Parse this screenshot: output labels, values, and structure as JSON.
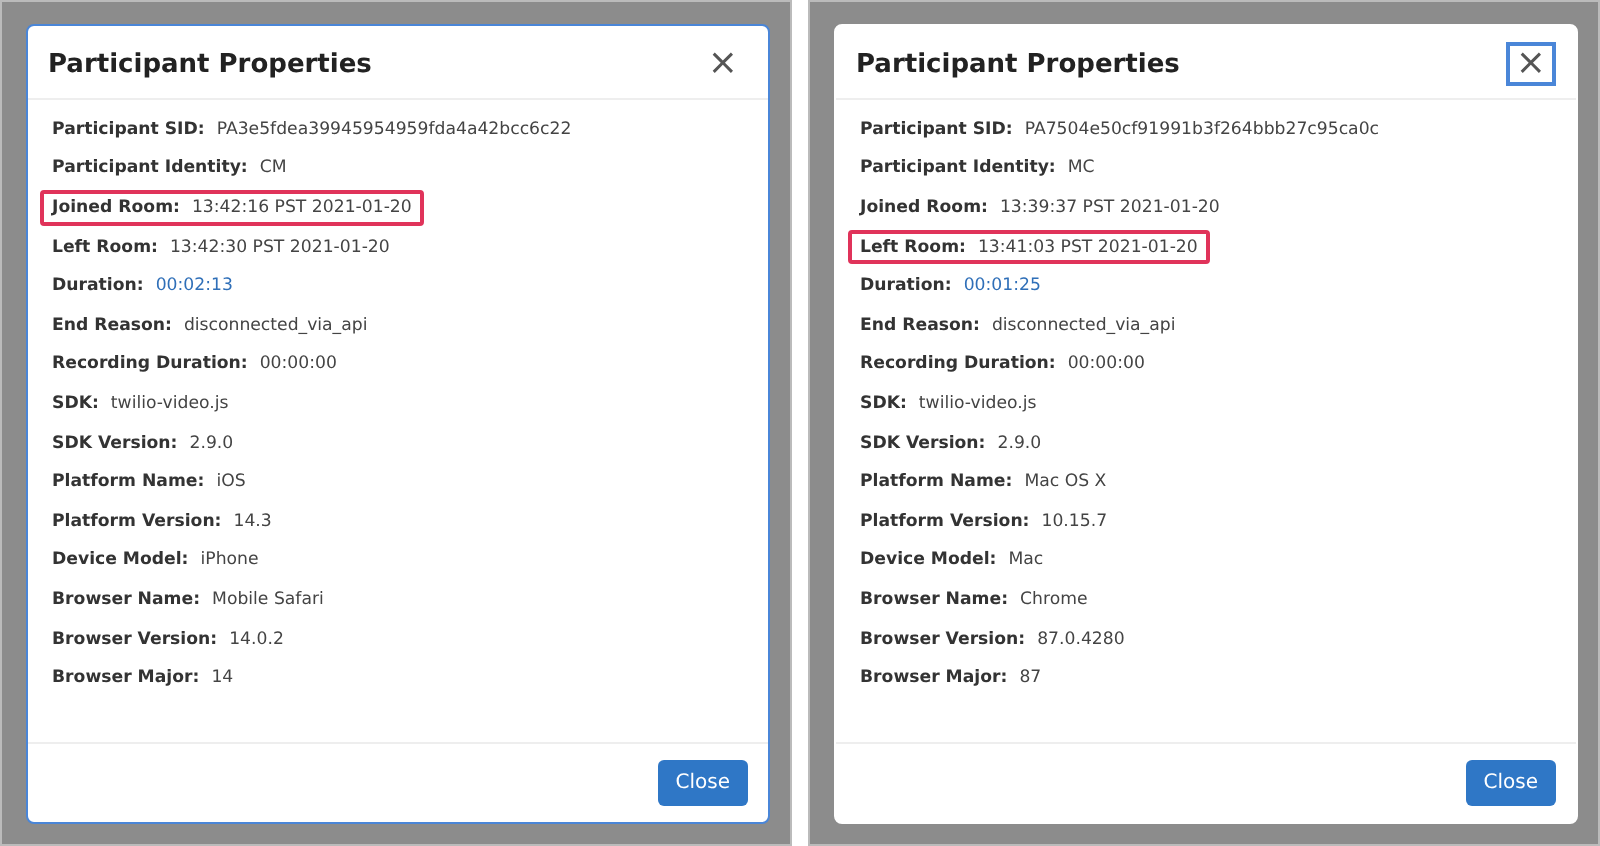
{
  "dialogs": [
    {
      "title": "Participant Properties",
      "focused": true,
      "close_focused": false,
      "close_label": "×",
      "button": "Close",
      "fields": [
        {
          "label": "Participant SID:",
          "value": "PA3e5fdea39945954959fda4a42bcc6c22",
          "kind": "text",
          "highlighted": false
        },
        {
          "label": "Participant Identity:",
          "value": "CM",
          "kind": "text",
          "highlighted": false
        },
        {
          "label": "Joined Room:",
          "value": "13:42:16 PST 2021-01-20",
          "kind": "text",
          "highlighted": true
        },
        {
          "label": "Left Room:",
          "value": "13:42:30 PST 2021-01-20",
          "kind": "text",
          "highlighted": false
        },
        {
          "label": "Duration:",
          "value": "00:02:13",
          "kind": "link",
          "highlighted": false
        },
        {
          "label": "End Reason:",
          "value": "disconnected_via_api",
          "kind": "text",
          "highlighted": false
        },
        {
          "label": "Recording Duration:",
          "value": "00:00:00",
          "kind": "text",
          "highlighted": false
        },
        {
          "label": "SDK:",
          "value": "twilio-video.js",
          "kind": "text",
          "highlighted": false
        },
        {
          "label": "SDK Version:",
          "value": "2.9.0",
          "kind": "text",
          "highlighted": false
        },
        {
          "label": "Platform Name:",
          "value": "iOS",
          "kind": "text",
          "highlighted": false
        },
        {
          "label": "Platform Version:",
          "value": "14.3",
          "kind": "text",
          "highlighted": false
        },
        {
          "label": "Device Model:",
          "value": "iPhone",
          "kind": "text",
          "highlighted": false
        },
        {
          "label": "Browser Name:",
          "value": "Mobile Safari",
          "kind": "text",
          "highlighted": false
        },
        {
          "label": "Browser Version:",
          "value": "14.0.2",
          "kind": "text",
          "highlighted": false
        },
        {
          "label": "Browser Major:",
          "value": "14",
          "kind": "text",
          "highlighted": false
        }
      ]
    },
    {
      "title": "Participant Properties",
      "focused": false,
      "close_focused": true,
      "close_label": "×",
      "button": "Close",
      "fields": [
        {
          "label": "Participant SID:",
          "value": "PA7504e50cf91991b3f264bbb27c95ca0c",
          "kind": "text",
          "highlighted": false
        },
        {
          "label": "Participant Identity:",
          "value": "MC",
          "kind": "text",
          "highlighted": false
        },
        {
          "label": "Joined Room:",
          "value": "13:39:37 PST 2021-01-20",
          "kind": "text",
          "highlighted": false
        },
        {
          "label": "Left Room:",
          "value": "13:41:03 PST 2021-01-20",
          "kind": "text",
          "highlighted": true
        },
        {
          "label": "Duration:",
          "value": "00:01:25",
          "kind": "link",
          "highlighted": false
        },
        {
          "label": "End Reason:",
          "value": "disconnected_via_api",
          "kind": "text",
          "highlighted": false
        },
        {
          "label": "Recording Duration:",
          "value": "00:00:00",
          "kind": "text",
          "highlighted": false
        },
        {
          "label": "SDK:",
          "value": "twilio-video.js",
          "kind": "text",
          "highlighted": false
        },
        {
          "label": "SDK Version:",
          "value": "2.9.0",
          "kind": "text",
          "highlighted": false
        },
        {
          "label": "Platform Name:",
          "value": "Mac OS X",
          "kind": "text",
          "highlighted": false
        },
        {
          "label": "Platform Version:",
          "value": "10.15.7",
          "kind": "text",
          "highlighted": false
        },
        {
          "label": "Device Model:",
          "value": "Mac",
          "kind": "text",
          "highlighted": false
        },
        {
          "label": "Browser Name:",
          "value": "Chrome",
          "kind": "text",
          "highlighted": false
        },
        {
          "label": "Browser Version:",
          "value": "87.0.4280",
          "kind": "text",
          "highlighted": false
        },
        {
          "label": "Browser Major:",
          "value": "87",
          "kind": "text",
          "highlighted": false
        }
      ]
    }
  ]
}
